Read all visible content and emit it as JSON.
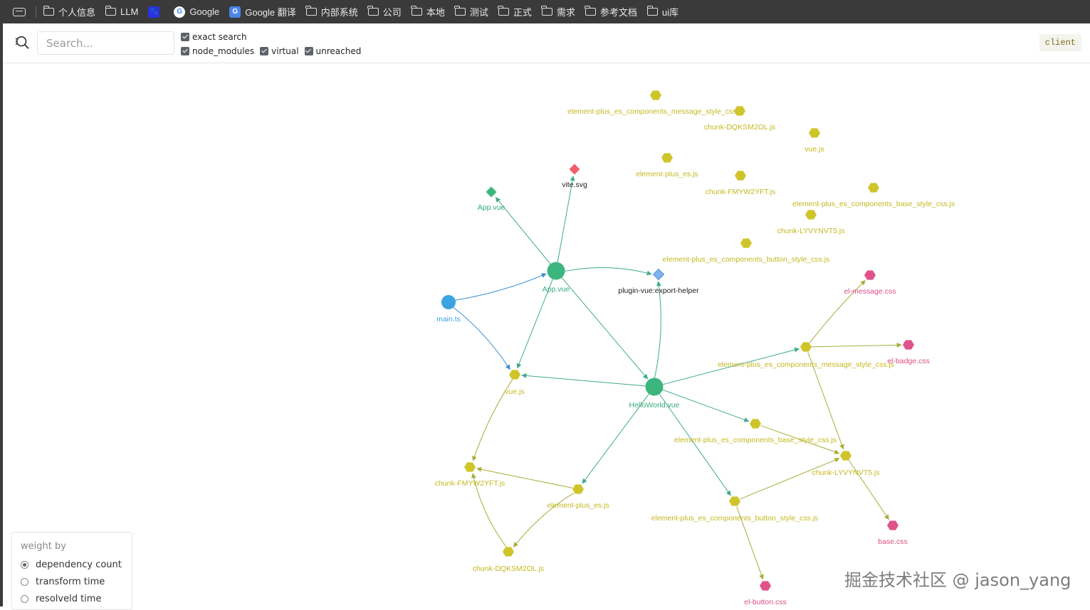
{
  "bookmarks": [
    {
      "label": "个人信息",
      "icon": "folder-icon"
    },
    {
      "label": "LLM",
      "icon": "folder-icon"
    },
    {
      "label": "",
      "icon": "baidu-icon"
    },
    {
      "label": "Google",
      "icon": "google-icon"
    },
    {
      "label": "Google 翻译",
      "icon": "google-translate-icon"
    },
    {
      "label": "内部系统",
      "icon": "folder-icon"
    },
    {
      "label": "公司",
      "icon": "folder-icon"
    },
    {
      "label": "本地",
      "icon": "folder-icon"
    },
    {
      "label": "测试",
      "icon": "folder-icon"
    },
    {
      "label": "正式",
      "icon": "folder-icon"
    },
    {
      "label": "需求",
      "icon": "folder-icon"
    },
    {
      "label": "参考文档",
      "icon": "folder-icon"
    },
    {
      "label": "ui库",
      "icon": "folder-icon"
    }
  ],
  "search": {
    "placeholder": "Search...",
    "value": ""
  },
  "filters": [
    {
      "label": "exact search",
      "checked": true
    },
    {
      "label": "node_modules",
      "checked": true
    },
    {
      "label": "virtual",
      "checked": true
    },
    {
      "label": "unreached",
      "checked": true
    }
  ],
  "environment_badge": "client",
  "weight_panel": {
    "title": "weight by",
    "options": [
      {
        "label": "dependency count",
        "selected": true
      },
      {
        "label": "transform time",
        "selected": false
      },
      {
        "label": "resolveld time",
        "selected": false
      }
    ]
  },
  "colors": {
    "vue": "#3cb57f",
    "ts": "#3ba3e0",
    "js": "#cfc52a",
    "css": "#e0538a",
    "svg": "#f0606a",
    "virtual": "#7fb3ef"
  },
  "graph": {
    "nodes": [
      {
        "id": "main",
        "label": "main.ts",
        "kind": "ts",
        "shape": "circle"
      },
      {
        "id": "appvue",
        "label": "App.vue",
        "kind": "vue",
        "shape": "circle"
      },
      {
        "id": "appvue2",
        "label": "App.vue",
        "kind": "vue",
        "shape": "diamond"
      },
      {
        "id": "vitesvg",
        "label": "vite.svg",
        "kind": "svg",
        "shape": "diamond"
      },
      {
        "id": "helper",
        "label": "plugin-vue:export-helper",
        "kind": "virtual",
        "shape": "diamond"
      },
      {
        "id": "hello",
        "label": "HelloWorld.vue",
        "kind": "vue",
        "shape": "circle"
      },
      {
        "id": "vuejs",
        "label": "vue.js",
        "kind": "js",
        "shape": "hex"
      },
      {
        "id": "fmy",
        "label": "chunk-FMYW2YFT.js",
        "kind": "js",
        "shape": "hex"
      },
      {
        "id": "dqk",
        "label": "chunk-DQKSM2OL.js",
        "kind": "js",
        "shape": "hex"
      },
      {
        "id": "ep",
        "label": "element-plus_es.js",
        "kind": "js",
        "shape": "hex"
      },
      {
        "id": "msgstyle",
        "label": "element-plus_es_components_message_style_css.js",
        "kind": "js",
        "shape": "hex"
      },
      {
        "id": "basestyle",
        "label": "element-plus_es_components_base_style_css.js",
        "kind": "js",
        "shape": "hex"
      },
      {
        "id": "btnstyle",
        "label": "element-plus_es_components_button_style_css.js",
        "kind": "js",
        "shape": "hex"
      },
      {
        "id": "lyv",
        "label": "chunk-LYVYNVT5.js",
        "kind": "js",
        "shape": "hex"
      },
      {
        "id": "elmsg",
        "label": "el-message.css",
        "kind": "css",
        "shape": "hex"
      },
      {
        "id": "elbadge",
        "label": "el-badge.css",
        "kind": "css",
        "shape": "hex"
      },
      {
        "id": "basecss",
        "label": "base.css",
        "kind": "css",
        "shape": "hex"
      },
      {
        "id": "elbtn",
        "label": "el-button.css",
        "kind": "css",
        "shape": "hex"
      },
      {
        "id": "u1",
        "label": "element-plus_es_components_message_style_css.js",
        "kind": "js",
        "shape": "hex"
      },
      {
        "id": "u2",
        "label": "chunk-DQKSM2OL.js",
        "kind": "js",
        "shape": "hex"
      },
      {
        "id": "u3",
        "label": "vue.js",
        "kind": "js",
        "shape": "hex"
      },
      {
        "id": "u4",
        "label": "element-plus_es.js",
        "kind": "js",
        "shape": "hex"
      },
      {
        "id": "u5",
        "label": "chunk-FMYW2YFT.js",
        "kind": "js",
        "shape": "hex"
      },
      {
        "id": "u6",
        "label": "element-plus_es_components_base_style_css.js",
        "kind": "js",
        "shape": "hex"
      },
      {
        "id": "u7",
        "label": "chunk-LYVYNVT5.js",
        "kind": "js",
        "shape": "hex"
      },
      {
        "id": "u8",
        "label": "element-plus_es_components_button_style_css.js",
        "kind": "js",
        "shape": "hex"
      }
    ],
    "edges": [
      [
        "main",
        "appvue"
      ],
      [
        "main",
        "vuejs"
      ],
      [
        "appvue",
        "appvue2"
      ],
      [
        "appvue",
        "vitesvg"
      ],
      [
        "appvue",
        "helper"
      ],
      [
        "appvue",
        "vuejs"
      ],
      [
        "appvue",
        "hello"
      ],
      [
        "hello",
        "helper"
      ],
      [
        "hello",
        "vuejs"
      ],
      [
        "hello",
        "msgstyle"
      ],
      [
        "hello",
        "basestyle"
      ],
      [
        "hello",
        "ep"
      ],
      [
        "hello",
        "btnstyle"
      ],
      [
        "vuejs",
        "fmy"
      ],
      [
        "ep",
        "fmy"
      ],
      [
        "ep",
        "dqk"
      ],
      [
        "dqk",
        "fmy"
      ],
      [
        "msgstyle",
        "elmsg"
      ],
      [
        "msgstyle",
        "elbadge"
      ],
      [
        "msgstyle",
        "lyv"
      ],
      [
        "basestyle",
        "lyv"
      ],
      [
        "btnstyle",
        "lyv"
      ],
      [
        "btnstyle",
        "elbtn"
      ],
      [
        "lyv",
        "basecss"
      ]
    ]
  },
  "watermark": "掘金技术社区 @ jason_yang"
}
